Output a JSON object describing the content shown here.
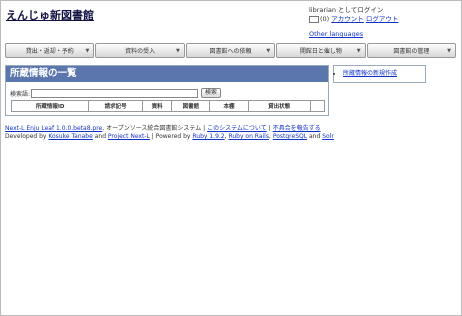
{
  "header": {
    "site_title": "えんじゅ新図書館",
    "login_status": "librarian としてログイン",
    "message_count": "(0)",
    "account_link": "アカウント",
    "logout_link": "ログアウト",
    "other_languages": "Other languages"
  },
  "menu": [
    {
      "label": "貸出・返却・予約"
    },
    {
      "label": "資料の受入"
    },
    {
      "label": "図書館への依頼"
    },
    {
      "label": "開館日と催し物"
    },
    {
      "label": "図書館の管理"
    }
  ],
  "main": {
    "heading": "所蔵情報の一覧",
    "search_label": "検索語:",
    "search_value": "",
    "search_button": "検索",
    "columns": [
      "所蔵情報ID",
      "請求記号",
      "資料",
      "図書館",
      "本棚",
      "貸出状態",
      ""
    ]
  },
  "sidebar": {
    "new_item": "所蔵情報の新規作成"
  },
  "footer": {
    "app_link": "Next-L Enju Leaf 1.0.0.beta8.pre",
    "app_desc": ", オープンソース統合図書館システム |",
    "about_link": "このシステムについて",
    "sep1": " |",
    "report_link": "不具合を報告する",
    "dev_by": "Developed by ",
    "author_link": "Kosuke Tanabe",
    "and": " and ",
    "project_link": "Project Next-L",
    "powered": " | Powered by ",
    "ruby_link": "Ruby 1.9.2",
    "c1": ", ",
    "rails_link": "Ruby on Rails",
    "c2": ", ",
    "pg_link": "PostgreSQL",
    "and2": " and ",
    "solr_link": "Solr"
  }
}
